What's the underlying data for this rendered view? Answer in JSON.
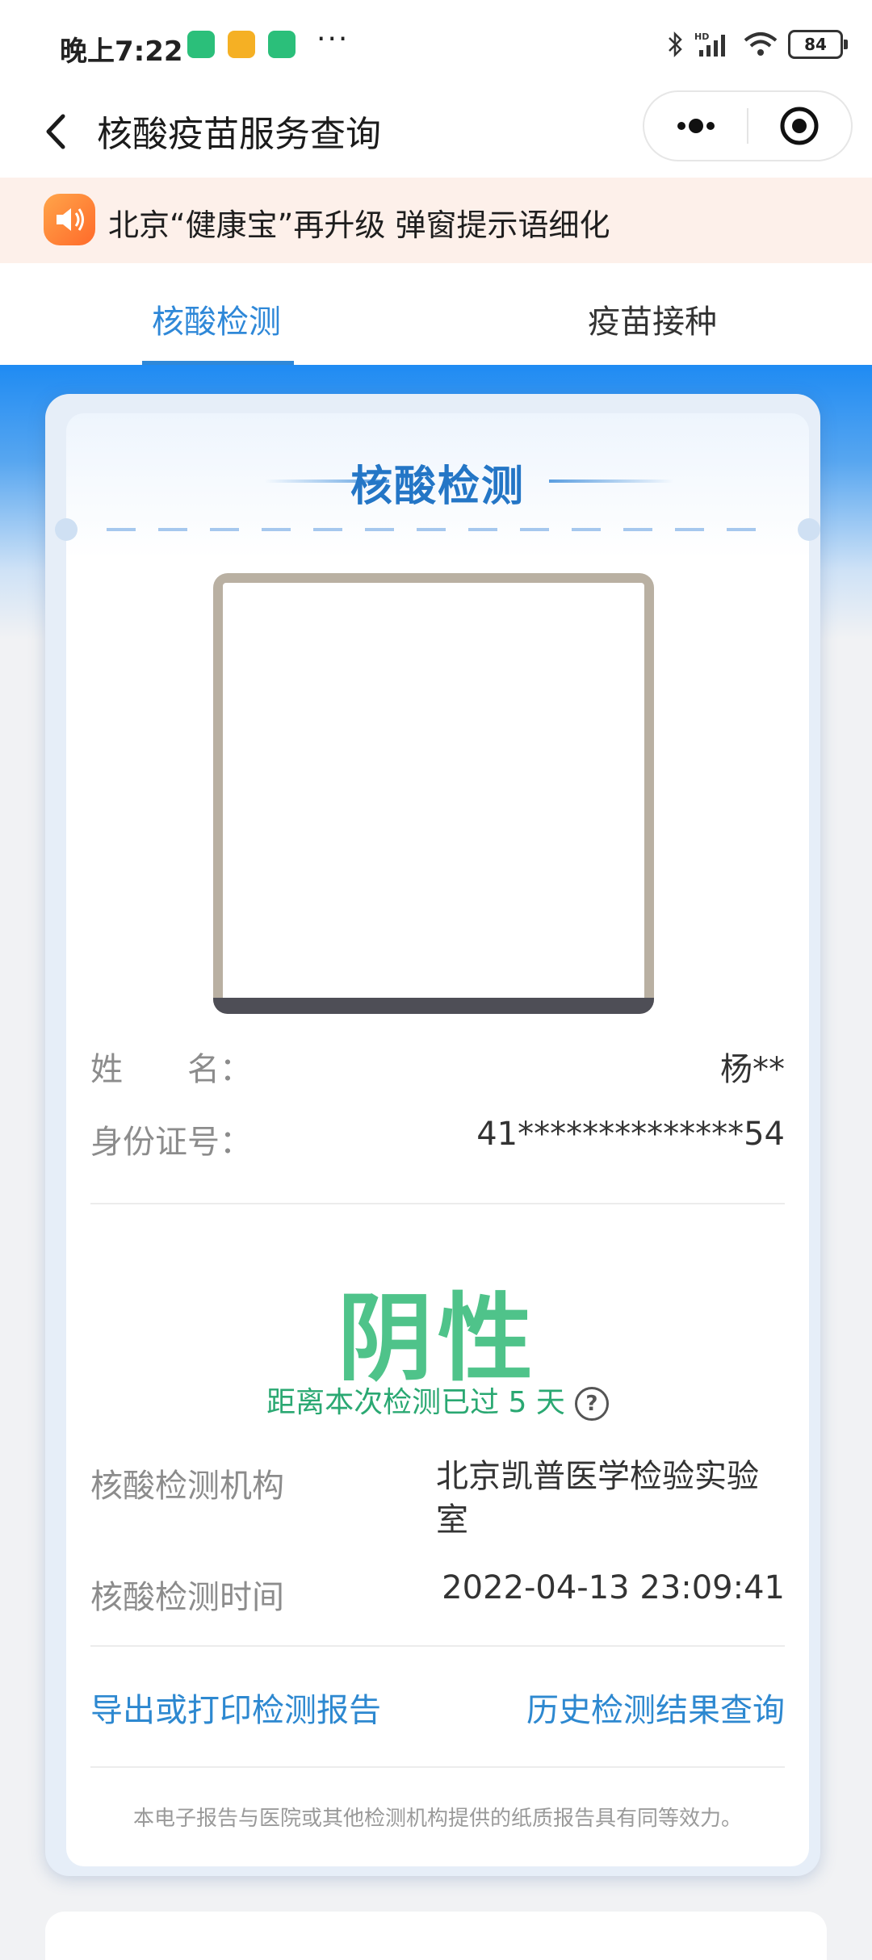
{
  "status_bar": {
    "time": "晚上7:22",
    "more": "···",
    "battery": "84",
    "icons": [
      "bluetooth-icon",
      "hd-signal-icon",
      "wifi-icon",
      "battery-icon"
    ]
  },
  "nav": {
    "title": "核酸疫苗服务查询"
  },
  "notice": {
    "text": "北京“健康宝”再升级 弹窗提示语细化"
  },
  "tabs": [
    {
      "label": "核酸检测",
      "active": true
    },
    {
      "label": "疫苗接种",
      "active": false
    }
  ],
  "card": {
    "title": "核酸检测",
    "name_label": "姓　　名：",
    "name_value": "杨**",
    "id_label": "身份证号：",
    "id_value": "41**************54",
    "result": "阴性",
    "elapsed": "距离本次检测已过 5 天",
    "help": "?",
    "institution_label": "核酸检测机构",
    "institution_value": "北京凯普医学检验实验室",
    "time_label": "核酸检测时间",
    "time_value": "2022-04-13 23:09:41",
    "export_link": "导出或打印检测报告",
    "history_link": "历史检测结果查询",
    "footnote": "本电子报告与医院或其他检测机构提供的纸质报告具有同等效力。"
  },
  "colors": {
    "accent_blue": "#2f88d8",
    "negative_green": "#4fc38a",
    "link_blue": "#2d88d0"
  }
}
